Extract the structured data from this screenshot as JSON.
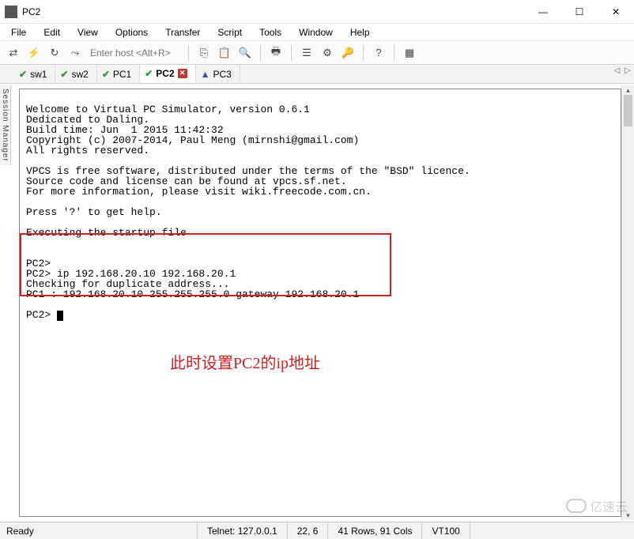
{
  "window": {
    "title": "PC2"
  },
  "menu": {
    "items": [
      "File",
      "Edit",
      "View",
      "Options",
      "Transfer",
      "Script",
      "Tools",
      "Window",
      "Help"
    ]
  },
  "toolbar": {
    "host_placeholder": "Enter host <Alt+R>"
  },
  "tabs": [
    {
      "label": "sw1",
      "status": "check"
    },
    {
      "label": "sw2",
      "status": "check"
    },
    {
      "label": "PC1",
      "status": "check"
    },
    {
      "label": "PC2",
      "status": "check",
      "active": true,
      "closebox": true
    },
    {
      "label": "PC3",
      "status": "warn"
    }
  ],
  "side_label": "Session Manager",
  "terminal": {
    "line1": "Welcome to Virtual PC Simulator, version 0.6.1",
    "line2": "Dedicated to Daling.",
    "line3": "Build time: Jun  1 2015 11:42:32",
    "line4": "Copyright (c) 2007-2014, Paul Meng (mirnshi@gmail.com)",
    "line5": "All rights reserved.",
    "line6": "",
    "line7": "VPCS is free software, distributed under the terms of the \"BSD\" licence.",
    "line8": "Source code and license can be found at vpcs.sf.net.",
    "line9": "For more information, please visit wiki.freecode.com.cn.",
    "line10": "",
    "line11": "Press '?' to get help.",
    "line12": "",
    "line13": "Executing the startup file",
    "line14": "",
    "line15": "",
    "line16": "PC2>",
    "line17": "PC2> ip 192.168.20.10 192.168.20.1",
    "line18": "Checking for duplicate address...",
    "line19": "PC1 : 192.168.20.10 255.255.255.0 gateway 192.168.20.1",
    "line20": "",
    "line21": "PC2> "
  },
  "annotation": "此时设置PC2的ip地址",
  "status": {
    "ready": "Ready",
    "telnet": "Telnet: 127.0.0.1",
    "cursor": "22,   6",
    "size": "41 Rows, 91 Cols",
    "term": "VT100"
  },
  "watermark": "亿速云"
}
